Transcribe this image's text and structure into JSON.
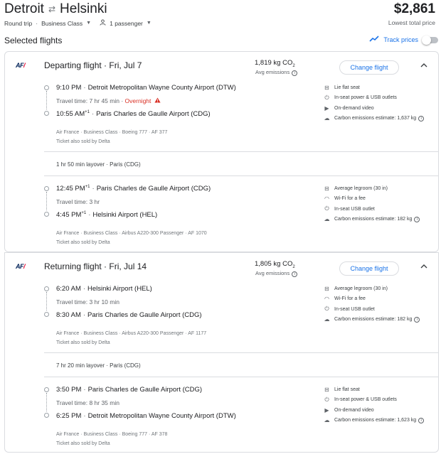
{
  "header": {
    "origin": "Detroit",
    "destination": "Helsinki",
    "swap_icon": "⇄",
    "trip_type": "Round trip",
    "cabin": "Business Class",
    "passengers": "1 passenger",
    "price": "$2,861",
    "price_label": "Lowest total price"
  },
  "selected": {
    "title": "Selected flights",
    "track_label": "Track prices"
  },
  "outbound": {
    "airline_logo": "AF",
    "title": "Departing flight",
    "date": "Fri, Jul 7",
    "co2": "1,819 kg CO",
    "co2_sub": "2",
    "avg": "Avg emissions",
    "change": "Change flight",
    "seg1": {
      "dep_time": "9:10 PM",
      "dep_airport": "Detroit Metropolitan Wayne County Airport (DTW)",
      "travel": "Travel time: 7 hr 45 min",
      "overnight": "Overnight",
      "arr_time": "10:55 AM",
      "arr_sup": "+1",
      "arr_airport": "Paris Charles de Gaulle Airport (CDG)",
      "meta1": "Air France · Business Class · Boeing 777 · AF 377",
      "meta2": "Ticket also sold by Delta",
      "amenities": [
        "Lie flat seat",
        "In-seat power & USB outlets",
        "On-demand video",
        "Carbon emissions estimate: 1,637 kg"
      ]
    },
    "layover": "1 hr 50 min layover · Paris (CDG)",
    "seg2": {
      "dep_time": "12:45 PM",
      "dep_sup": "+1",
      "dep_airport": "Paris Charles de Gaulle Airport (CDG)",
      "travel": "Travel time: 3 hr",
      "arr_time": "4:45 PM",
      "arr_sup": "+1",
      "arr_airport": "Helsinki Airport (HEL)",
      "meta1": "Air France · Business Class · Airbus A220-300 Passenger · AF 1070",
      "meta2": "Ticket also sold by Delta",
      "amenities": [
        "Average legroom (30 in)",
        "Wi-Fi for a fee",
        "In-seat USB outlet",
        "Carbon emissions estimate: 182 kg"
      ]
    }
  },
  "inbound": {
    "airline_logo": "AF",
    "title": "Returning flight",
    "date": "Fri, Jul 14",
    "co2": "1,805 kg CO",
    "co2_sub": "2",
    "avg": "Avg emissions",
    "change": "Change flight",
    "seg1": {
      "dep_time": "6:20 AM",
      "dep_airport": "Helsinki Airport (HEL)",
      "travel": "Travel time: 3 hr 10 min",
      "arr_time": "8:30 AM",
      "arr_airport": "Paris Charles de Gaulle Airport (CDG)",
      "meta1": "Air France · Business Class · Airbus A220-300 Passenger · AF 1177",
      "meta2": "Ticket also sold by Delta",
      "amenities": [
        "Average legroom (30 in)",
        "Wi-Fi for a fee",
        "In-seat USB outlet",
        "Carbon emissions estimate: 182 kg"
      ]
    },
    "layover": "7 hr 20 min layover · Paris (CDG)",
    "seg2": {
      "dep_time": "3:50 PM",
      "dep_airport": "Paris Charles de Gaulle Airport (CDG)",
      "travel": "Travel time: 8 hr 35 min",
      "arr_time": "6:25 PM",
      "arr_airport": "Detroit Metropolitan Wayne County Airport (DTW)",
      "meta1": "Air France · Business Class · Boeing 777 · AF 378",
      "meta2": "Ticket also sold by Delta",
      "amenities": [
        "Lie flat seat",
        "In-seat power & USB outlets",
        "On-demand video",
        "Carbon emissions estimate: 1,623 kg"
      ]
    }
  },
  "colors": {
    "accent": "#1a73e8",
    "warning": "#d93025",
    "af_blue": "#002157",
    "af_red": "#e4002b"
  }
}
